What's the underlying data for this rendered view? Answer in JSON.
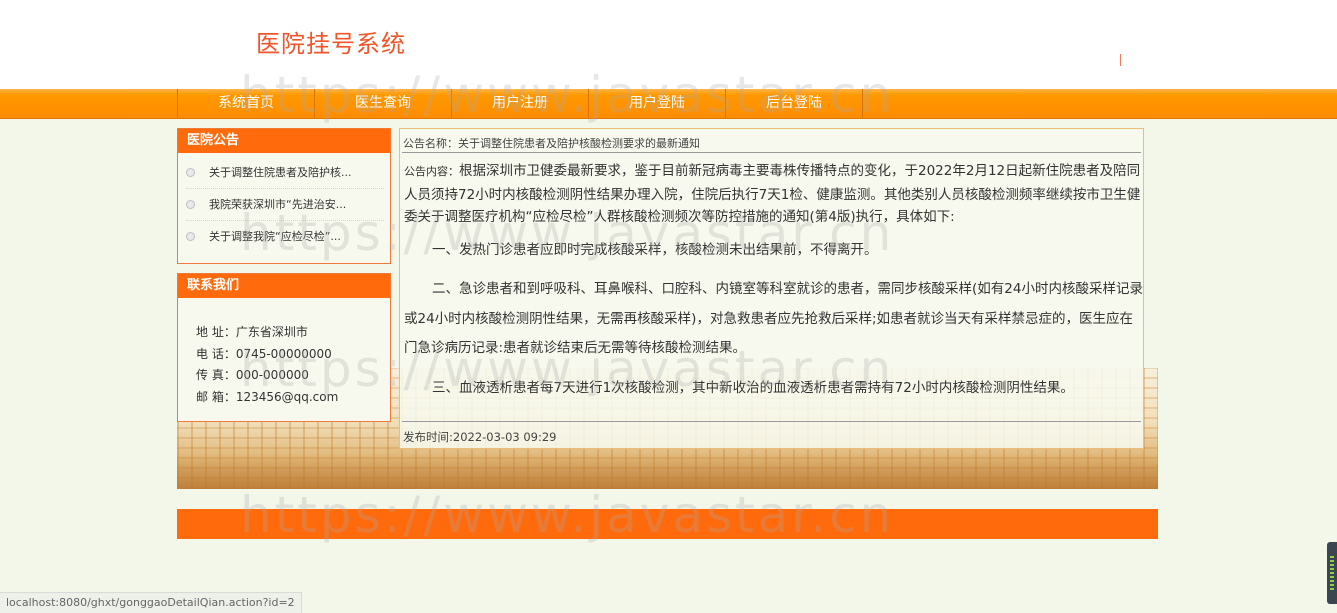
{
  "site": {
    "title": "医院挂号系统"
  },
  "nav": {
    "items": [
      {
        "label": "系统首页"
      },
      {
        "label": "医生查询"
      },
      {
        "label": "用户注册"
      },
      {
        "label": "用户登陆"
      },
      {
        "label": "后台登陆"
      }
    ]
  },
  "notices": {
    "heading": "医院公告",
    "items": [
      {
        "label": "关于调整住院患者及陪护核..."
      },
      {
        "label": "我院荣获深圳市“先进治安..."
      },
      {
        "label": "关于调整我院“应检尽检”..."
      }
    ]
  },
  "contact": {
    "heading": "联系我们",
    "address": "地 址：广东省深圳市",
    "phone": "电 话：0745-00000000",
    "fax": "传 真：000-000000",
    "email": "邮 箱：123456@qq.com"
  },
  "article": {
    "title": "公告名称：关于调整住院患者及陪护核酸检测要求的最新通知",
    "content_label": "公告内容：",
    "intro": "根据深圳市卫健委最新要求，鉴于目前新冠病毒主要毒株传播特点的变化，于2022年2月12日起新住院患者及陪同人员须持72小时内核酸检测阴性结果办理入院，住院后执行7天1检、健康监测。其他类别人员核酸检测频率继续按市卫生健委关于调整医疗机构“应检尽检”人群核酸检测频次等防控措施的通知(第4版)执行，具体如下:",
    "point1": "一、发热门诊患者应即时完成核酸采样，核酸检测未出结果前，不得离开。",
    "point2": "二、急诊患者和到呼吸科、耳鼻喉科、口腔科、内镜室等科室就诊的患者，需同步核酸采样(如有24小时内核酸采样记录或24小时内核酸检测阴性结果，无需再核酸采样)，对急救患者应先抢救后采样;如患者就诊当天有采样禁忌症的，医生应在门急诊病历记录:患者就诊结束后无需等待核酸检测结果。",
    "point3": "三、血液透析患者每7天进行1次核酸检测，其中新收治的血液透析患者需持有72小时内核酸检测阴性结果。",
    "publish_time": "发布时间:2022-03-03 09:29"
  },
  "watermark": {
    "text": "https://www.javastar.cn"
  },
  "status_bar": {
    "url": "localhost:8080/ghxt/gonggaoDetailQian.action?id=2"
  },
  "colors": {
    "accent": "#ff6a0c",
    "nav": "#ff9900",
    "title": "#f0542a",
    "background": "#f2f7e9"
  }
}
